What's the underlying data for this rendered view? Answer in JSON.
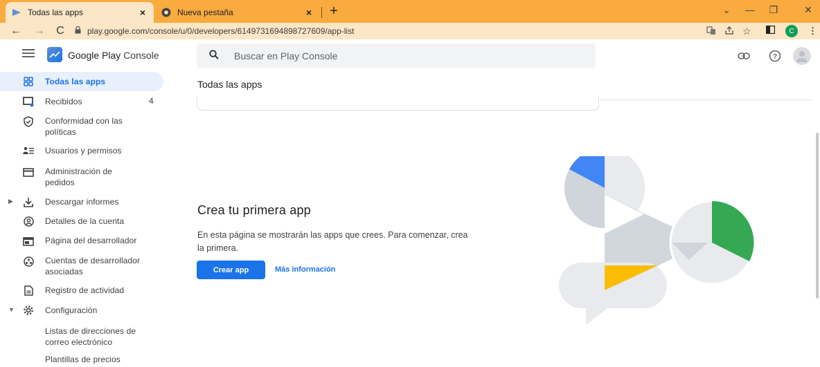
{
  "browser": {
    "tabs": [
      {
        "title": "Todas las apps",
        "close": "×"
      },
      {
        "title": "Nueva pestaña",
        "close": "×"
      }
    ],
    "new_tab": "+",
    "url": "play.google.com/console/u/0/developers/6149731694898727609/app-list",
    "profile_initial": "C",
    "window_controls": {
      "minimize": "—",
      "restore": "❐",
      "close": "✕",
      "tabsearch": "⌄"
    }
  },
  "header": {
    "brand": "Google Play Console",
    "brand_part1": "Google Play",
    "brand_part2": "Console",
    "search_placeholder": "Buscar en Play Console"
  },
  "sidebar": {
    "items": [
      {
        "label": "Todas las apps",
        "icon": "grid-icon"
      },
      {
        "label": "Recibidos",
        "count": "4",
        "icon": "inbox-icon"
      },
      {
        "label": "Conformidad con las políticas",
        "line1": "Conformidad con las",
        "line2": "políticas",
        "icon": "shield-icon"
      },
      {
        "label": "Usuarios y permisos",
        "icon": "users-icon"
      },
      {
        "label": "Administración de pedidos",
        "line1": "Administración de",
        "line2": "pedidos",
        "icon": "card-icon"
      },
      {
        "label": "Descargar informes",
        "icon": "download-icon"
      },
      {
        "label": "Detalles de la cuenta",
        "icon": "account-icon"
      },
      {
        "label": "Página del desarrollador",
        "icon": "page-icon"
      },
      {
        "label": "Cuentas de desarrollador asociadas",
        "line1": "Cuentas de desarrollador",
        "line2": "asociadas",
        "icon": "linked-accounts-icon"
      },
      {
        "label": "Registro de actividad",
        "icon": "log-icon"
      },
      {
        "label": "Configuración",
        "icon": "gear-icon"
      },
      {
        "label": "Listas de direcciones de correo electrónico",
        "line1": "Listas de direcciones de",
        "line2": "correo electrónico"
      },
      {
        "label": "Plantillas de precios"
      }
    ]
  },
  "main": {
    "page_title": "Todas las apps",
    "empty_title": "Crea tu primera app",
    "empty_desc_line1": "En esta página se mostrarán las apps que crees. Para comenzar, crea",
    "empty_desc_line2": "la primera.",
    "create_button": "Crear app",
    "more_info_link": "Más información"
  },
  "colors": {
    "accent": "#1a73e8",
    "tabbar": "#f9ab3f",
    "addrbar": "#fbe6c6",
    "illu_blue": "#4285f4",
    "illu_green": "#34a853",
    "illu_yellow": "#fbbc04",
    "illu_grey": "#e8eaed"
  }
}
